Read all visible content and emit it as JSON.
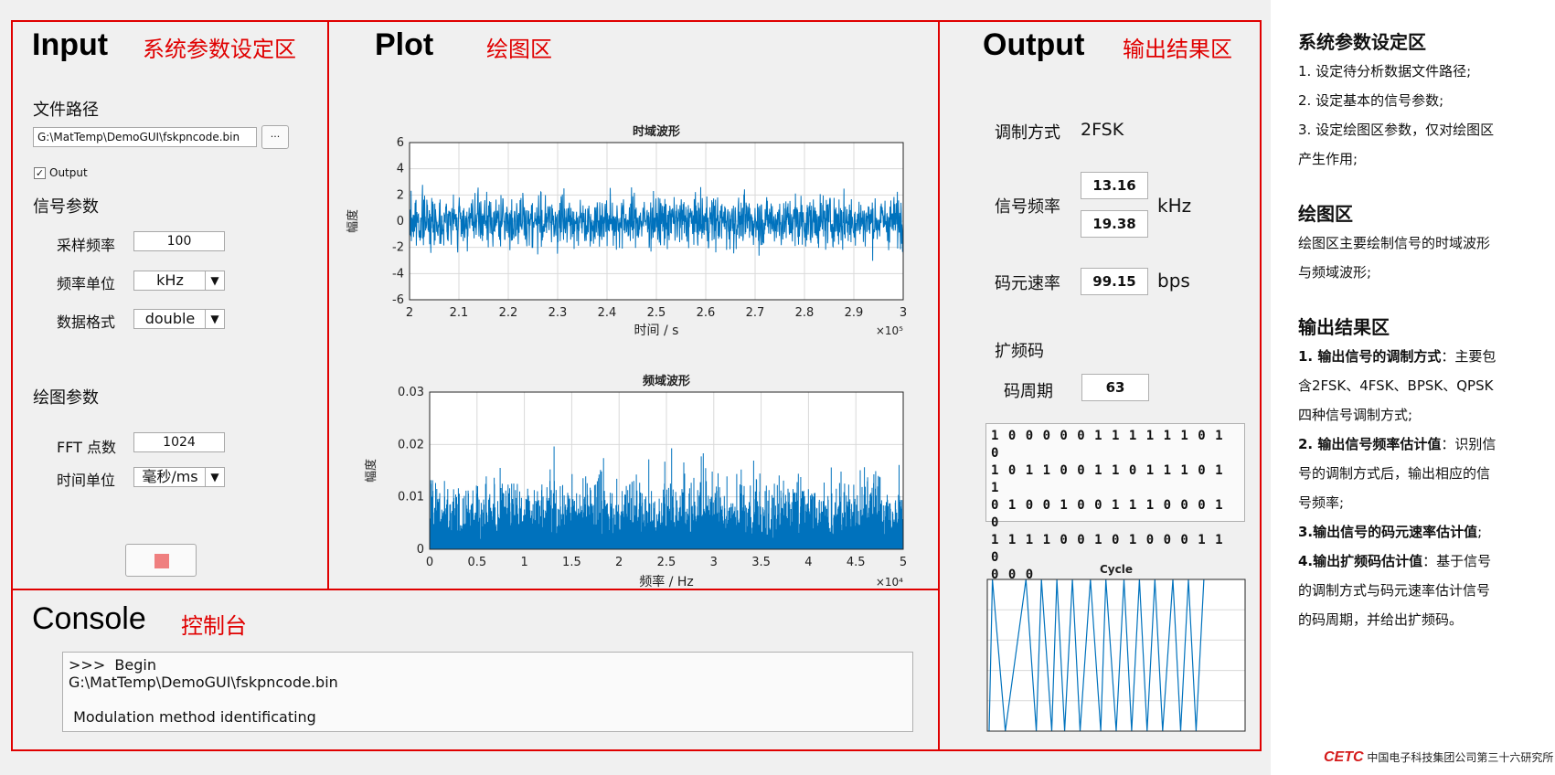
{
  "panels": {
    "input": {
      "title": "Input",
      "subtitle": "系统参数设定区"
    },
    "plot": {
      "title": "Plot",
      "subtitle": "绘图区"
    },
    "output": {
      "title": "Output",
      "subtitle": "输出结果区"
    },
    "console": {
      "title": "Console",
      "subtitle": "控制台"
    }
  },
  "input": {
    "file_path_label": "文件路径",
    "file_path_value": "G:\\MatTemp\\DemoGUI\\fskpncode.bin",
    "browse_label": "···",
    "output_checkbox_label": "Output",
    "output_checked": true,
    "signal_params_label": "信号参数",
    "sample_rate_label": "采样频率",
    "sample_rate_value": "100",
    "freq_unit_label": "频率单位",
    "freq_unit_value": "kHz",
    "data_format_label": "数据格式",
    "data_format_value": "double",
    "plot_params_label": "绘图参数",
    "fft_label": "FFT 点数",
    "fft_value": "1024",
    "time_unit_label": "时间单位",
    "time_unit_value": "毫秒/ms",
    "stop_button_color": "#ef7f7f"
  },
  "chart_data": [
    {
      "type": "line",
      "title": "时域波形",
      "xlabel": "时间 / s",
      "ylabel": "幅度",
      "x_exponent": "×10⁵",
      "xlim": [
        2,
        3
      ],
      "ylim": [
        -6,
        6
      ],
      "xticks": [
        "2",
        "2.1",
        "2.2",
        "2.3",
        "2.4",
        "2.5",
        "2.6",
        "2.7",
        "2.8",
        "2.9",
        "3"
      ],
      "yticks": [
        "6",
        "4",
        "2",
        "0",
        "-2",
        "-4",
        "-6"
      ],
      "series_color": "#0072bd",
      "grid": true
    },
    {
      "type": "line",
      "title": "频域波形",
      "xlabel": "频率 / Hz",
      "ylabel": "幅度",
      "x_exponent": "×10⁴",
      "xlim": [
        0,
        5
      ],
      "ylim": [
        0,
        0.03
      ],
      "xticks": [
        "0",
        "0.5",
        "1",
        "1.5",
        "2",
        "2.5",
        "3",
        "3.5",
        "4",
        "4.5",
        "5"
      ],
      "yticks": [
        "0.03",
        "0.02",
        "0.01",
        "0"
      ],
      "series_color": "#0072bd",
      "grid": true
    },
    {
      "type": "line",
      "title": "Cycle",
      "series_color": "#0072bd",
      "grid": true
    }
  ],
  "output": {
    "modulation_label": "调制方式",
    "modulation_value": "2FSK",
    "freq_label": "信号频率",
    "freq1": "13.16",
    "freq2": "19.38",
    "freq_unit": "kHz",
    "baud_label": "码元速率",
    "baud_value": "99.15",
    "baud_unit": "bps",
    "spread_label": "扩频码",
    "period_label": "码周期",
    "period_value": "63",
    "code_lines": [
      "1 0 0 0 0 0 1 1 1 1 1 1 0 1 0",
      "1 0 1 1 0 0 1 1 0 1 1 1 0 1 1",
      "0 1 0 0 1 0 0 1 1 1 0 0 0 1 0",
      "1 1 1 1 0 0 1 0 1 0 0 0 1 1 0",
      "0 0 0"
    ]
  },
  "console": {
    "lines": [
      ">>>  Begin",
      "G:\\MatTemp\\DemoGUI\\fskpncode.bin",
      "",
      " Modulation method identificating"
    ]
  },
  "notes": {
    "s1_title": "系统参数设定区",
    "s1_items": [
      "1. 设定待分析数据文件路径;",
      "2. 设定基本的信号参数;",
      "3. 设定绘图区参数，仅对绘图区",
      "产生作用;"
    ],
    "s2_title": "绘图区",
    "s2_items": [
      "绘图区主要绘制信号的时域波形",
      "与频域波形;"
    ],
    "s3_title": "输出结果区",
    "s3_items": [
      {
        "b": "1. 输出信号的调制方式",
        "t": "：主要包"
      },
      {
        "b": "",
        "t": "含2FSK、4FSK、BPSK、QPSK"
      },
      {
        "b": "",
        "t": "四种信号调制方式;"
      },
      {
        "b": "2. 输出信号频率估计值",
        "t": "：识别信"
      },
      {
        "b": "",
        "t": "号的调制方式后，输出相应的信"
      },
      {
        "b": "",
        "t": "号频率;"
      },
      {
        "b": "3.输出信号的码元速率估计值",
        "t": ";"
      },
      {
        "b": "4.输出扩频码估计值",
        "t": "：基于信号"
      },
      {
        "b": "",
        "t": "的调制方式与码元速率估计信号"
      },
      {
        "b": "",
        "t": "的码周期，并给出扩频码。"
      }
    ]
  },
  "logo": {
    "brand": "CETC",
    "text": "中国电子科技集团公司第三十六研究所"
  }
}
